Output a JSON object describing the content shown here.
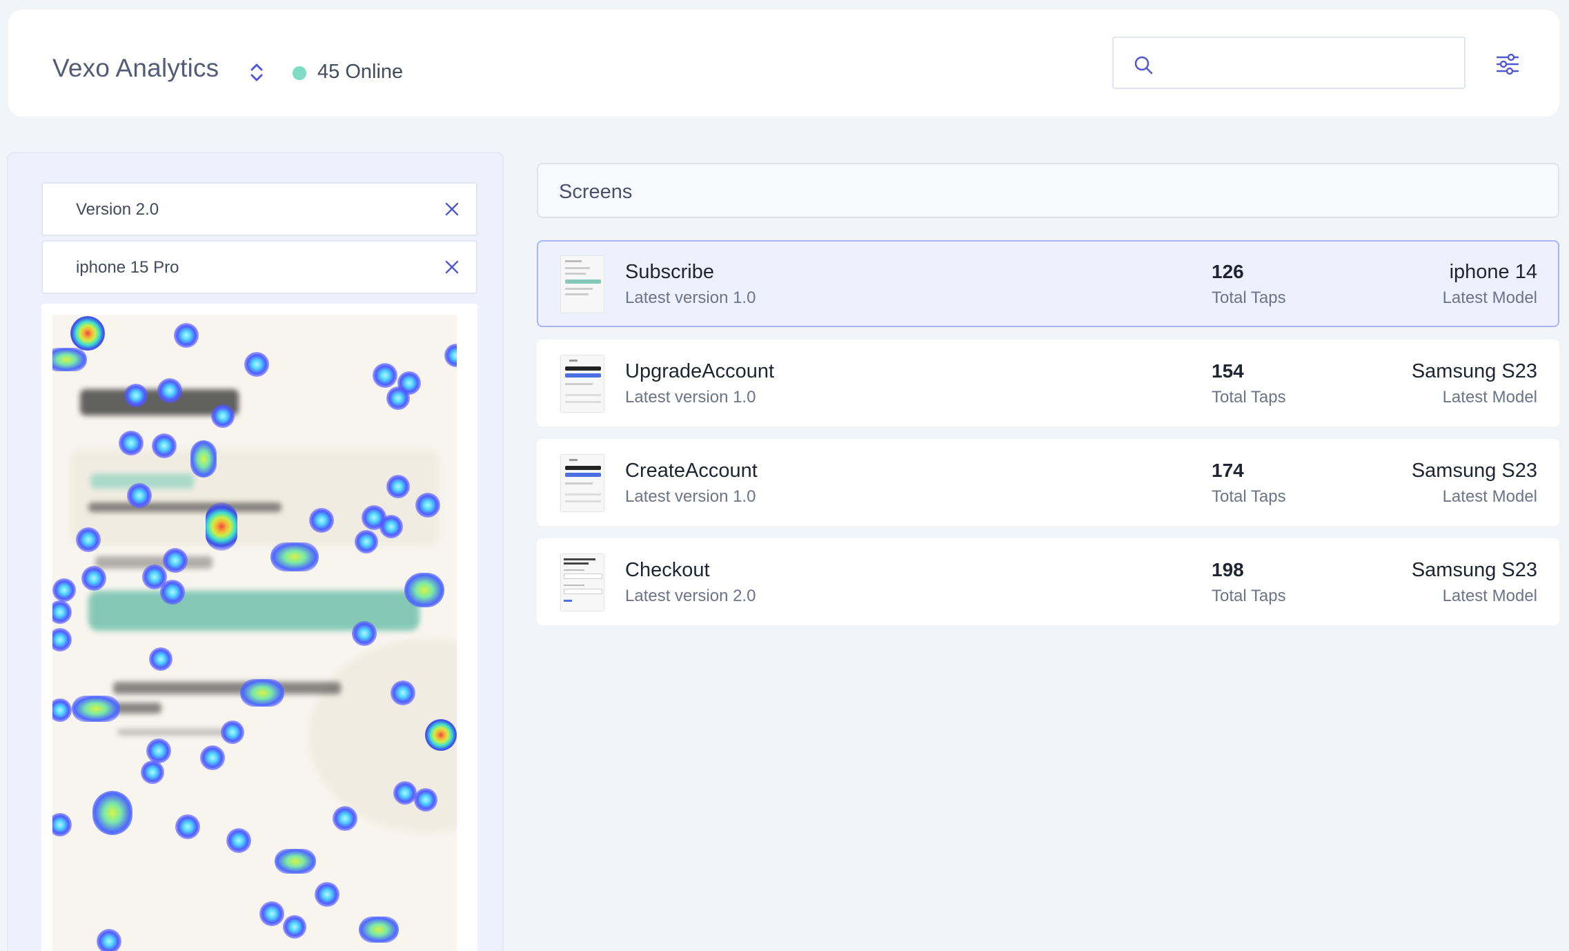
{
  "header": {
    "app_name": "Vexo Analytics",
    "online_label": "45 Online",
    "search_placeholder": "",
    "colors": {
      "online_dot": "#7ddcc3",
      "accent": "#5057d5"
    },
    "icons": {
      "switch": "chevron-up-down-icon",
      "search": "search-icon",
      "filters": "sliders-icon"
    }
  },
  "filters": [
    {
      "label": "Version 2.0"
    },
    {
      "label": "iphone 15 Pro"
    }
  ],
  "heatmap": {
    "content": "blurred screen preview with tap heatmap overlay"
  },
  "screens": {
    "title": "Screens",
    "rows": [
      {
        "name": "Subscribe",
        "version": "Latest version 1.0",
        "taps": "126",
        "taps_label": "Total Taps",
        "model": "iphone 14",
        "model_label": "Latest Model",
        "selected": true
      },
      {
        "name": "UpgradeAccount",
        "version": "Latest version 1.0",
        "taps": "154",
        "taps_label": "Total Taps",
        "model": "Samsung S23",
        "model_label": "Latest Model",
        "selected": false
      },
      {
        "name": "CreateAccount",
        "version": "Latest version 1.0",
        "taps": "174",
        "taps_label": "Total Taps",
        "model": "Samsung S23",
        "model_label": "Latest Model",
        "selected": false
      },
      {
        "name": "Checkout",
        "version": "Latest version 2.0",
        "taps": "198",
        "taps_label": "Total Taps",
        "model": "Samsung S23",
        "model_label": "Latest Model",
        "selected": false
      }
    ]
  }
}
